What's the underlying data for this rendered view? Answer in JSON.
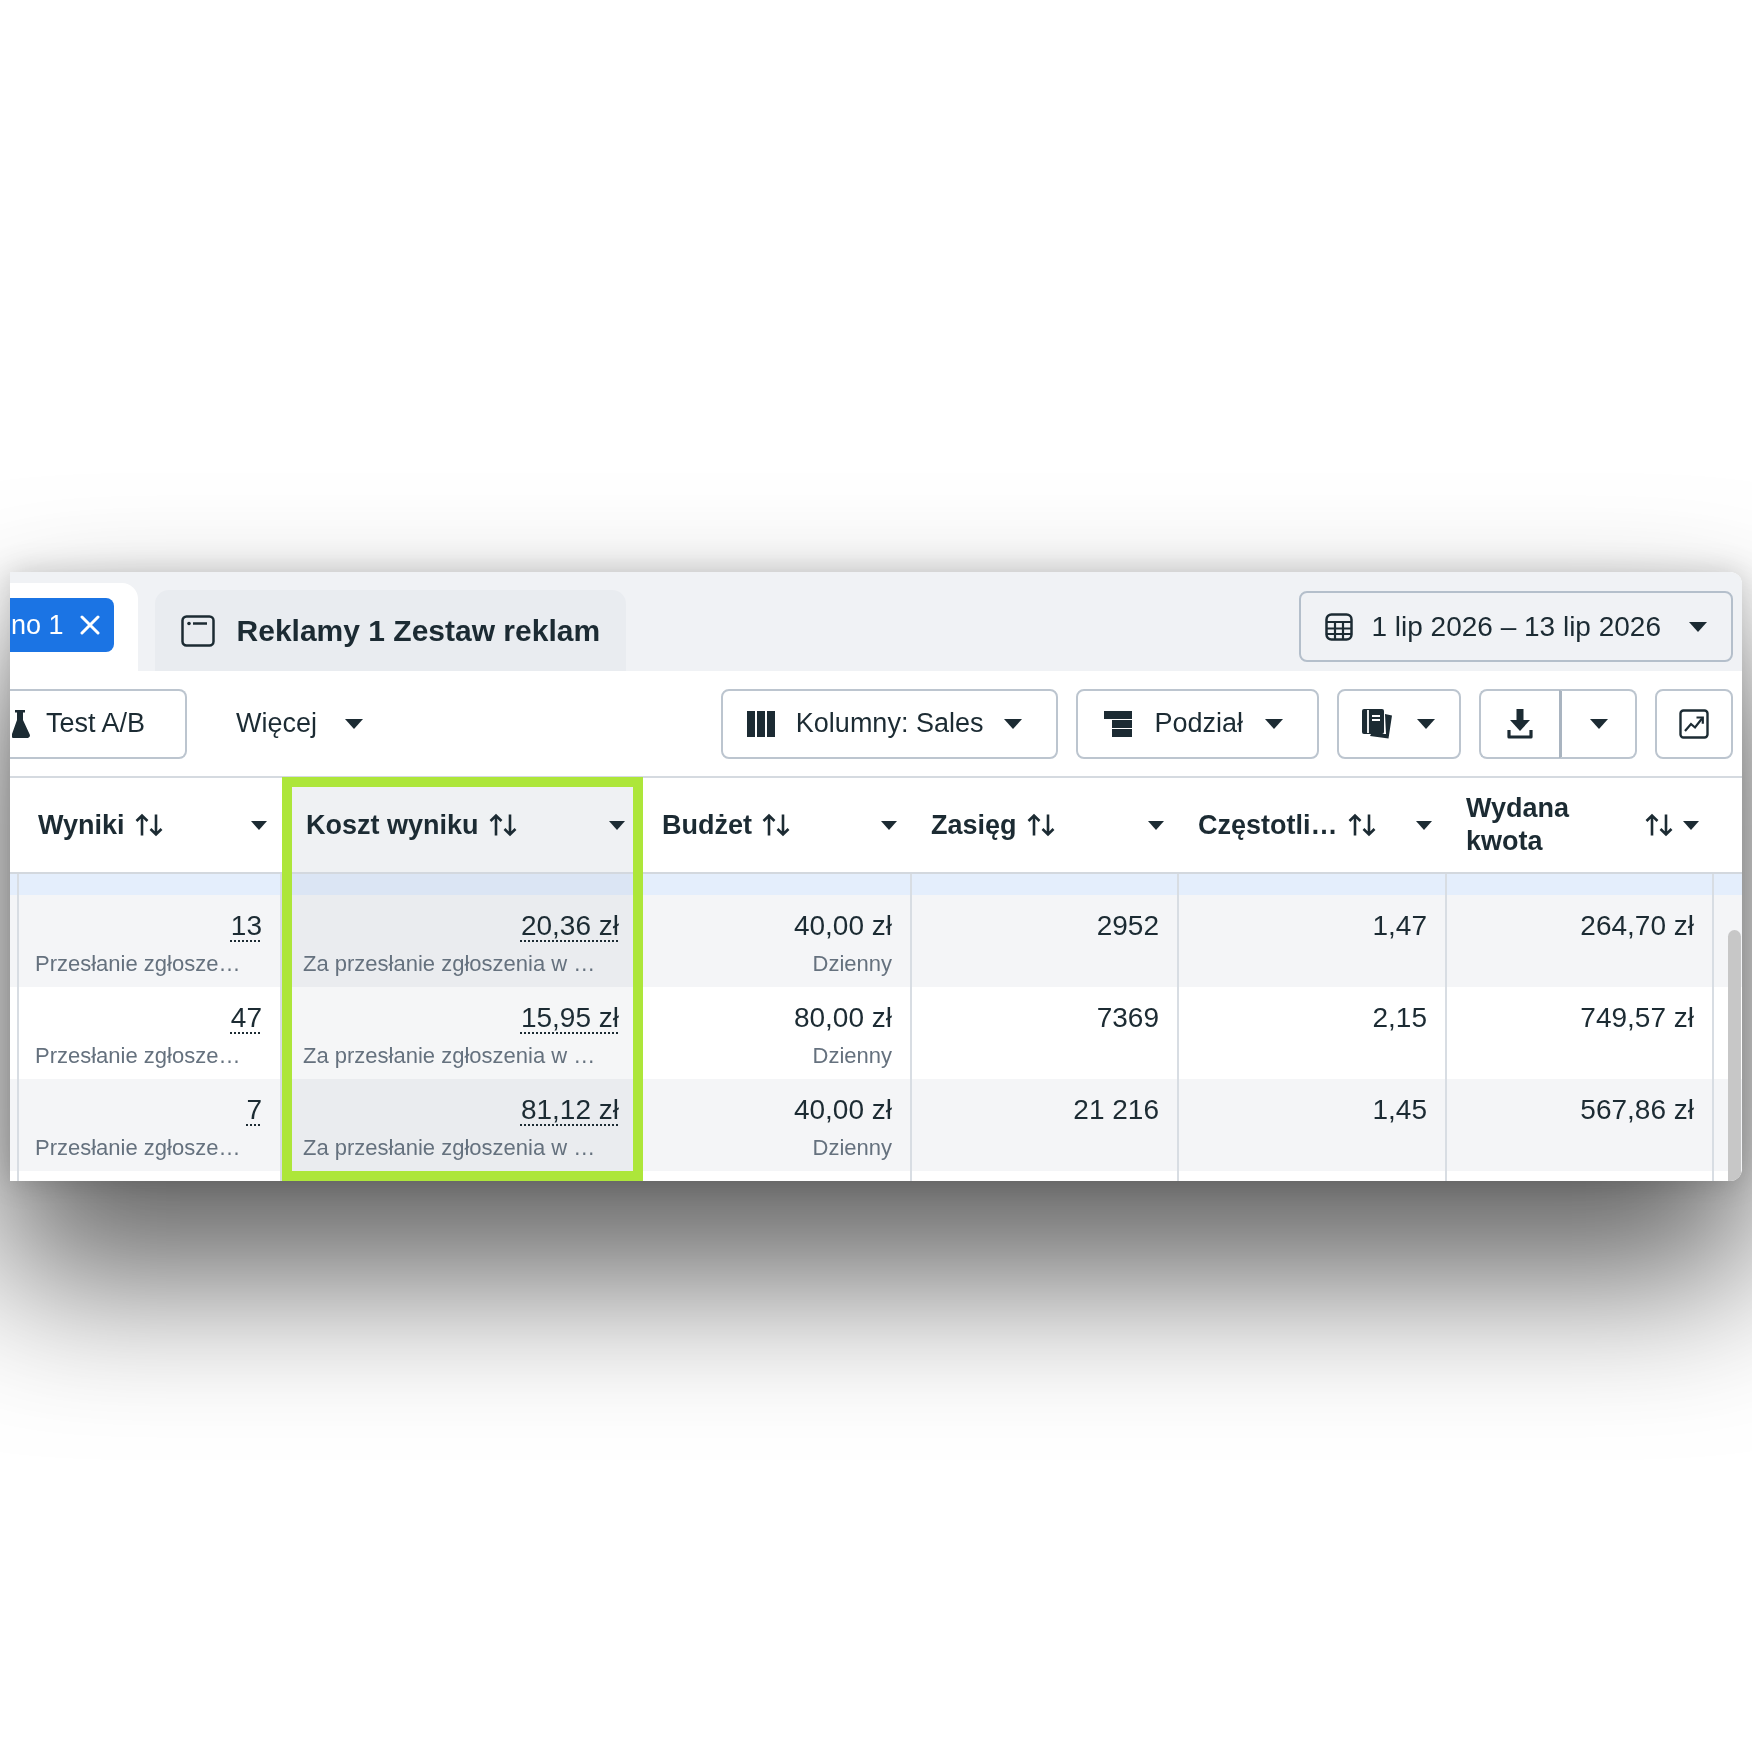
{
  "tabs": [
    {
      "chip": "no 1",
      "selected": true
    },
    {
      "label": "Reklamy 1 Zestaw reklam",
      "selected": false
    }
  ],
  "date_range": {
    "label": "1 lip 2026 – 13 lip 2026"
  },
  "toolbar": {
    "test_ab": "Test A/B",
    "more": "Więcej",
    "columns": "Kolumny: Sales",
    "breakdown": "Podział"
  },
  "table": {
    "columns": [
      {
        "label": "Wyniki",
        "kind": "result",
        "highlighted": false
      },
      {
        "label": "Koszt wyniku",
        "kind": "result",
        "highlighted": true
      },
      {
        "label": "Budżet",
        "kind": "budget",
        "highlighted": false
      },
      {
        "label": "Zasięg",
        "kind": "metric",
        "highlighted": false
      },
      {
        "label": "Częstotli…",
        "kind": "metric",
        "highlighted": false
      },
      {
        "label": "Wydana kwota",
        "kind": "metric",
        "highlighted": false
      }
    ],
    "rows": [
      {
        "kind": "clipped",
        "selected": true
      },
      {
        "kind": "full",
        "selected": false,
        "cells": [
          {
            "value": "13",
            "note": "Przesłanie zgłosze…"
          },
          {
            "value": "20,36 zł",
            "note": "Za przesłanie zgłoszenia w …"
          },
          {
            "value": "40,00 zł",
            "note": "Dzienny"
          },
          {
            "value": "2952"
          },
          {
            "value": "1,47"
          },
          {
            "value": "264,70 zł"
          }
        ]
      },
      {
        "kind": "full",
        "selected": false,
        "cells": [
          {
            "value": "47",
            "note": "Przesłanie zgłosze…"
          },
          {
            "value": "15,95 zł",
            "note": "Za przesłanie zgłoszenia w …"
          },
          {
            "value": "80,00 zł",
            "note": "Dzienny"
          },
          {
            "value": "7369"
          },
          {
            "value": "2,15"
          },
          {
            "value": "749,57 zł"
          }
        ]
      },
      {
        "kind": "full",
        "selected": false,
        "cells": [
          {
            "value": "7",
            "note": "Przesłanie zgłosze…"
          },
          {
            "value": "81,12 zł",
            "note": "Za przesłanie zgłoszenia w …"
          },
          {
            "value": "40,00 zł",
            "note": "Dzienny"
          },
          {
            "value": "21 216"
          },
          {
            "value": "1,45"
          },
          {
            "value": "567,86 zł"
          }
        ]
      }
    ]
  }
}
